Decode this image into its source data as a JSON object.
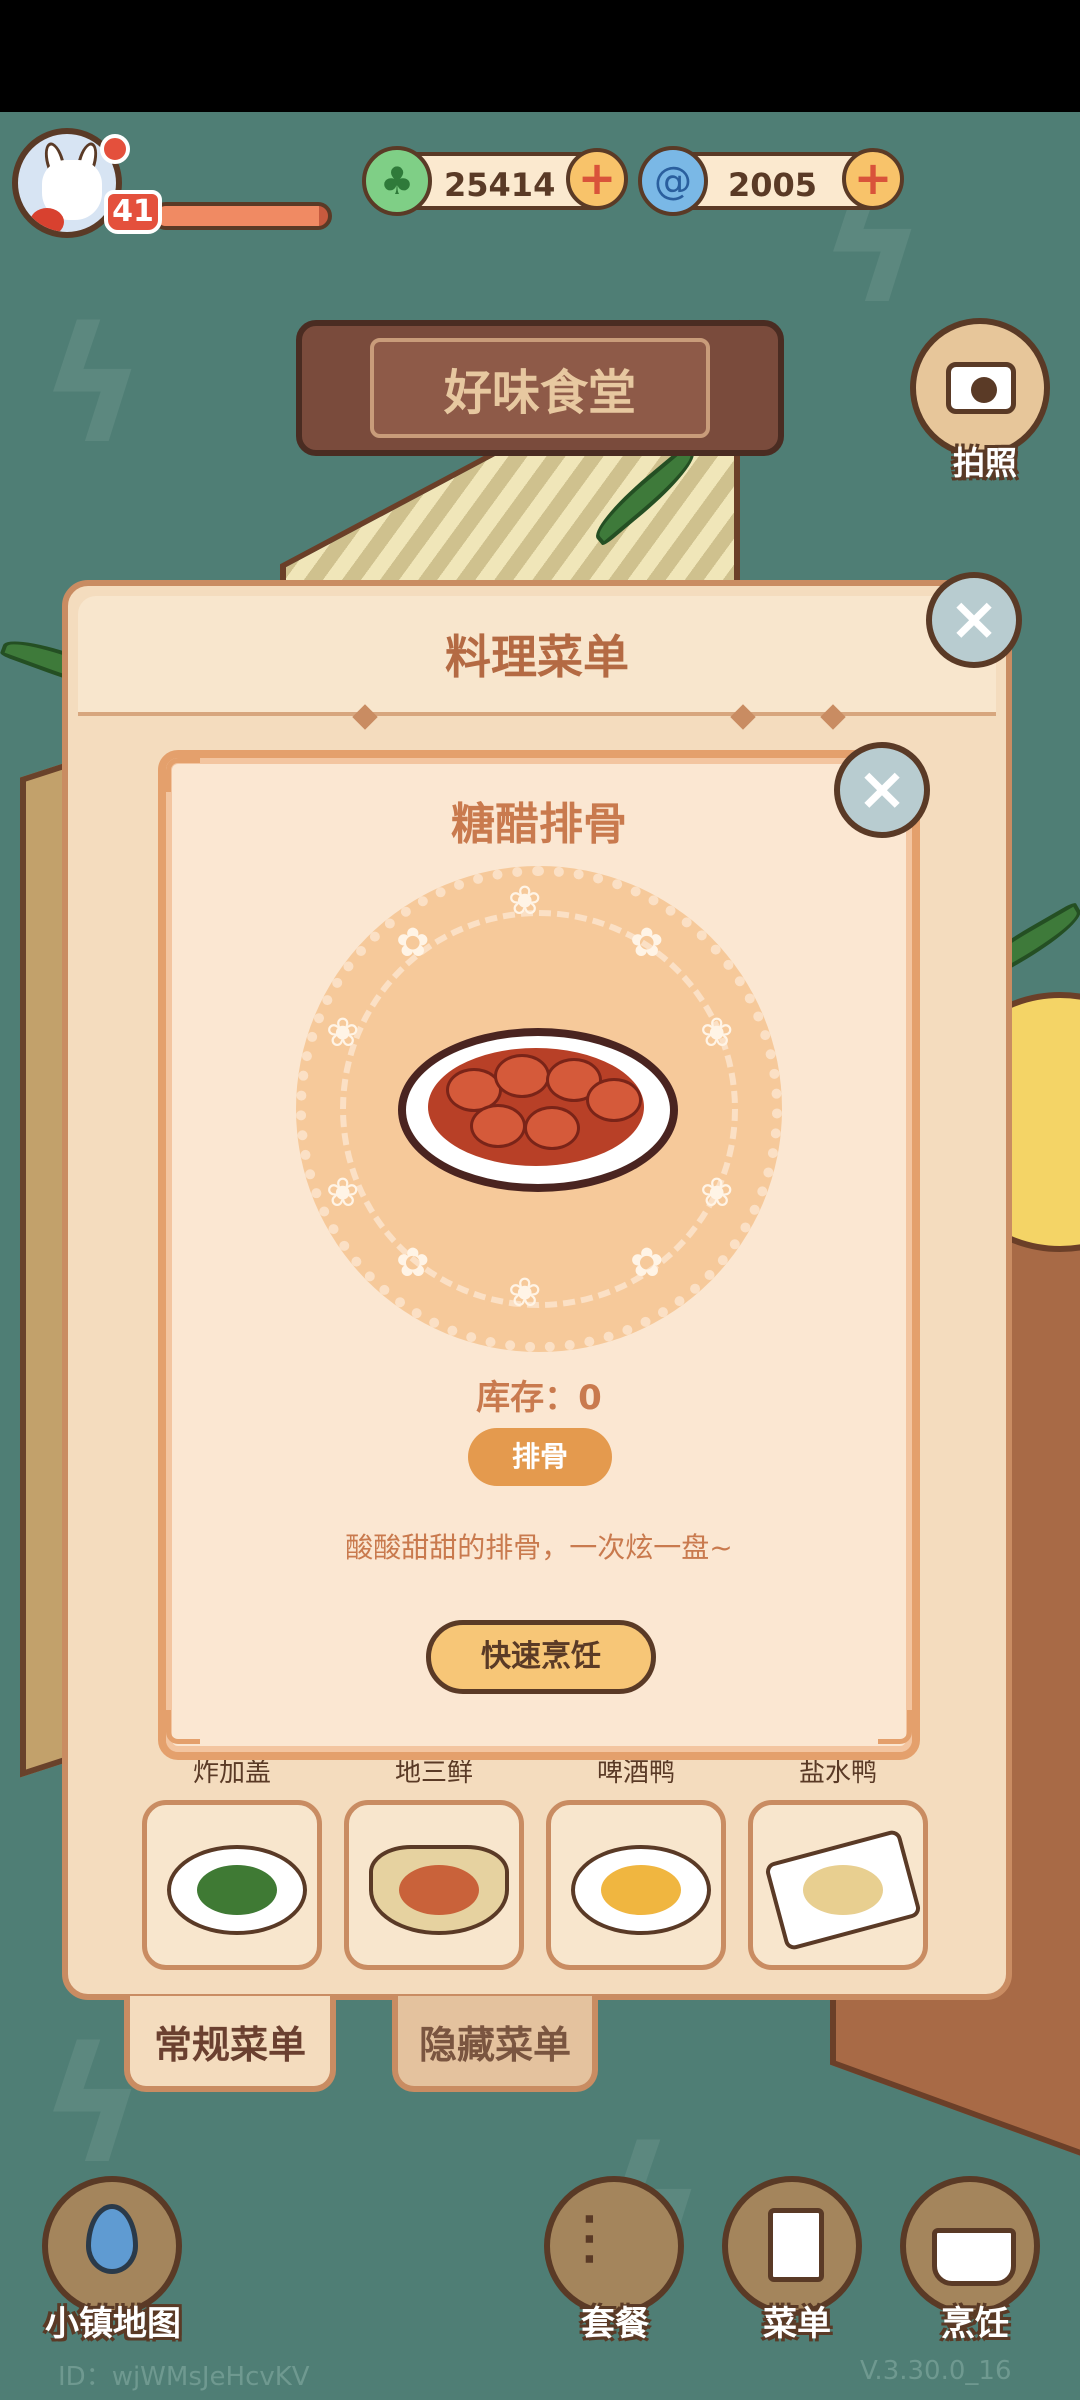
{
  "hud": {
    "level": "41",
    "xp_fraction": 0.95,
    "currency_green": "25414",
    "currency_blue": "2005",
    "plus_symbol": "+",
    "camera_label": "拍照"
  },
  "shop": {
    "sign": "好味食堂"
  },
  "panel": {
    "title": "料理菜单",
    "close_symbol": "×",
    "tabs": [
      {
        "label": "常规菜单",
        "active": true
      },
      {
        "label": "隐藏菜单",
        "active": false
      }
    ],
    "dishes": [
      {
        "name": "炸加盖"
      },
      {
        "name": "地三鲜"
      },
      {
        "name": "啤酒鸭"
      },
      {
        "name": "盐水鸭"
      }
    ]
  },
  "popup": {
    "title": "糖醋排骨",
    "close_symbol": "×",
    "stock_label": "库存：0",
    "ingredient": "排骨",
    "description": "酸酸甜甜的排骨，一次炫一盘~",
    "cook_button": "快速烹饪"
  },
  "bottom": {
    "map_label": "小镇地图",
    "set_meal_label": "套餐",
    "menu_label": "菜单",
    "cook_label": "烹饪",
    "id_text": "ID：wjWMsJeHcvKV",
    "version": "V.3.30.0_16"
  },
  "colors": {
    "background": "#4f7e75",
    "panel": "#f4dcbe",
    "accent_orange": "#e49a4e",
    "title_brown": "#c97a4e"
  }
}
